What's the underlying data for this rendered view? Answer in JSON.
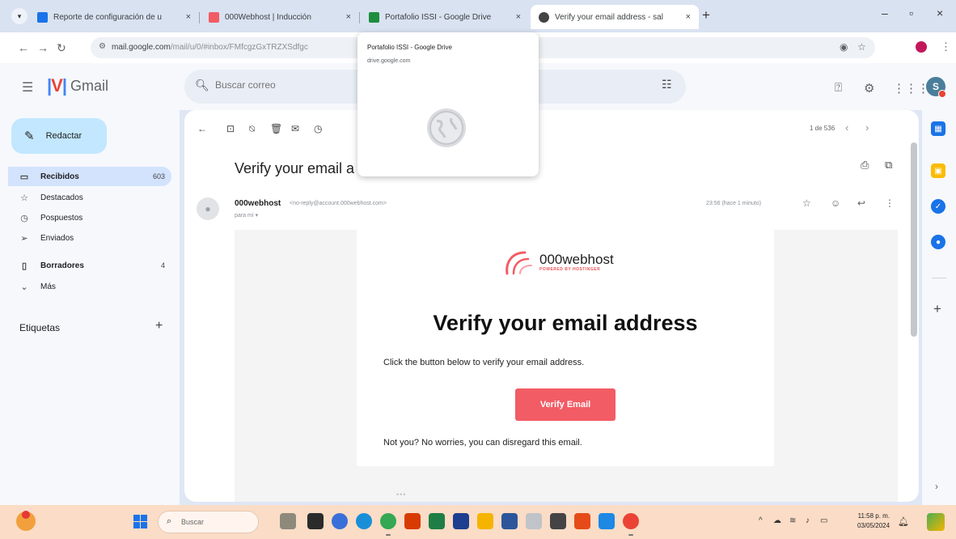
{
  "browser": {
    "tabs": [
      {
        "title": "Reporte de configuración de u",
        "favicon_color": "#1a73e8",
        "active": false
      },
      {
        "title": "000Webhost | Inducción",
        "favicon_color": "#f25c65",
        "active": false
      },
      {
        "title": "Portafolio ISSI - Google Drive",
        "favicon_color": "#1e8e3e",
        "active": false
      },
      {
        "title": "Verify your email address - sal",
        "favicon_color": "#444444",
        "active": true
      }
    ],
    "close_glyph": "×",
    "new_tab_glyph": "+",
    "window_controls": [
      "–",
      "▫",
      "×"
    ],
    "url_host": "mail.google.com",
    "url_path": "/mail/u/0/#inbox/FMfcgzGxTRZXSdfgc"
  },
  "hover_card": {
    "title": "Portafolio ISSI - Google Drive",
    "domain": "drive.google.com"
  },
  "gmail": {
    "app_name": "Gmail",
    "search_placeholder": "Buscar correo",
    "avatar_letter": "S",
    "compose_label": "Redactar",
    "nav": [
      {
        "label": "Recibidos",
        "count": "603",
        "icon": "inbox-icon",
        "glyph": "▭",
        "active": true,
        "bold": true
      },
      {
        "label": "Destacados",
        "count": "",
        "icon": "star-icon",
        "glyph": "☆",
        "active": false,
        "bold": false
      },
      {
        "label": "Pospuestos",
        "count": "",
        "icon": "clock-icon",
        "glyph": "◷",
        "active": false,
        "bold": false
      },
      {
        "label": "Enviados",
        "count": "",
        "icon": "send-icon",
        "glyph": "➢",
        "active": false,
        "bold": false
      },
      {
        "label": "Borradores",
        "count": "4",
        "icon": "draft-icon",
        "glyph": "▯",
        "active": false,
        "bold": true
      },
      {
        "label": "Más",
        "count": "",
        "icon": "chevron-down-icon",
        "glyph": "⌄",
        "active": false,
        "bold": false
      }
    ],
    "labels_title": "Etiquetas",
    "pager": "1 de 536"
  },
  "message": {
    "subject": "Verify your email a",
    "sender_name": "000webhost",
    "sender_email": "<no-reply@account.000webhost.com>",
    "to_line": "para mí ▾",
    "time": "23:56 (hace 1 minuto)"
  },
  "email_body": {
    "brand_name": "000webhost",
    "brand_tagline": "POWERED BY HOSTINGER",
    "title": "Verify your email address",
    "body": "Click the button below to verify your email address.",
    "button": "Verify Email",
    "footer": "Not you? No worries, you can disregard this email.",
    "accent": "#f25c65"
  },
  "taskbar": {
    "search_label": "Buscar",
    "time": "11:58 p. m.",
    "date": "03/05/2024"
  }
}
